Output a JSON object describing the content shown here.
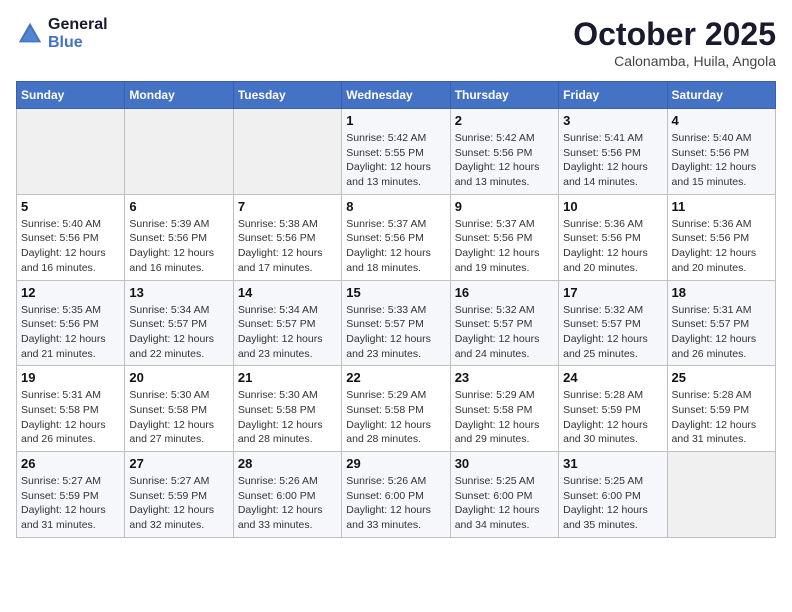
{
  "header": {
    "logo_line1": "General",
    "logo_line2": "Blue",
    "month": "October 2025",
    "location": "Calonamba, Huila, Angola"
  },
  "weekdays": [
    "Sunday",
    "Monday",
    "Tuesday",
    "Wednesday",
    "Thursday",
    "Friday",
    "Saturday"
  ],
  "weeks": [
    [
      {
        "day": "",
        "info": ""
      },
      {
        "day": "",
        "info": ""
      },
      {
        "day": "",
        "info": ""
      },
      {
        "day": "1",
        "info": "Sunrise: 5:42 AM\nSunset: 5:55 PM\nDaylight: 12 hours and 13 minutes."
      },
      {
        "day": "2",
        "info": "Sunrise: 5:42 AM\nSunset: 5:56 PM\nDaylight: 12 hours and 13 minutes."
      },
      {
        "day": "3",
        "info": "Sunrise: 5:41 AM\nSunset: 5:56 PM\nDaylight: 12 hours and 14 minutes."
      },
      {
        "day": "4",
        "info": "Sunrise: 5:40 AM\nSunset: 5:56 PM\nDaylight: 12 hours and 15 minutes."
      }
    ],
    [
      {
        "day": "5",
        "info": "Sunrise: 5:40 AM\nSunset: 5:56 PM\nDaylight: 12 hours and 16 minutes."
      },
      {
        "day": "6",
        "info": "Sunrise: 5:39 AM\nSunset: 5:56 PM\nDaylight: 12 hours and 16 minutes."
      },
      {
        "day": "7",
        "info": "Sunrise: 5:38 AM\nSunset: 5:56 PM\nDaylight: 12 hours and 17 minutes."
      },
      {
        "day": "8",
        "info": "Sunrise: 5:37 AM\nSunset: 5:56 PM\nDaylight: 12 hours and 18 minutes."
      },
      {
        "day": "9",
        "info": "Sunrise: 5:37 AM\nSunset: 5:56 PM\nDaylight: 12 hours and 19 minutes."
      },
      {
        "day": "10",
        "info": "Sunrise: 5:36 AM\nSunset: 5:56 PM\nDaylight: 12 hours and 20 minutes."
      },
      {
        "day": "11",
        "info": "Sunrise: 5:36 AM\nSunset: 5:56 PM\nDaylight: 12 hours and 20 minutes."
      }
    ],
    [
      {
        "day": "12",
        "info": "Sunrise: 5:35 AM\nSunset: 5:56 PM\nDaylight: 12 hours and 21 minutes."
      },
      {
        "day": "13",
        "info": "Sunrise: 5:34 AM\nSunset: 5:57 PM\nDaylight: 12 hours and 22 minutes."
      },
      {
        "day": "14",
        "info": "Sunrise: 5:34 AM\nSunset: 5:57 PM\nDaylight: 12 hours and 23 minutes."
      },
      {
        "day": "15",
        "info": "Sunrise: 5:33 AM\nSunset: 5:57 PM\nDaylight: 12 hours and 23 minutes."
      },
      {
        "day": "16",
        "info": "Sunrise: 5:32 AM\nSunset: 5:57 PM\nDaylight: 12 hours and 24 minutes."
      },
      {
        "day": "17",
        "info": "Sunrise: 5:32 AM\nSunset: 5:57 PM\nDaylight: 12 hours and 25 minutes."
      },
      {
        "day": "18",
        "info": "Sunrise: 5:31 AM\nSunset: 5:57 PM\nDaylight: 12 hours and 26 minutes."
      }
    ],
    [
      {
        "day": "19",
        "info": "Sunrise: 5:31 AM\nSunset: 5:58 PM\nDaylight: 12 hours and 26 minutes."
      },
      {
        "day": "20",
        "info": "Sunrise: 5:30 AM\nSunset: 5:58 PM\nDaylight: 12 hours and 27 minutes."
      },
      {
        "day": "21",
        "info": "Sunrise: 5:30 AM\nSunset: 5:58 PM\nDaylight: 12 hours and 28 minutes."
      },
      {
        "day": "22",
        "info": "Sunrise: 5:29 AM\nSunset: 5:58 PM\nDaylight: 12 hours and 28 minutes."
      },
      {
        "day": "23",
        "info": "Sunrise: 5:29 AM\nSunset: 5:58 PM\nDaylight: 12 hours and 29 minutes."
      },
      {
        "day": "24",
        "info": "Sunrise: 5:28 AM\nSunset: 5:59 PM\nDaylight: 12 hours and 30 minutes."
      },
      {
        "day": "25",
        "info": "Sunrise: 5:28 AM\nSunset: 5:59 PM\nDaylight: 12 hours and 31 minutes."
      }
    ],
    [
      {
        "day": "26",
        "info": "Sunrise: 5:27 AM\nSunset: 5:59 PM\nDaylight: 12 hours and 31 minutes."
      },
      {
        "day": "27",
        "info": "Sunrise: 5:27 AM\nSunset: 5:59 PM\nDaylight: 12 hours and 32 minutes."
      },
      {
        "day": "28",
        "info": "Sunrise: 5:26 AM\nSunset: 6:00 PM\nDaylight: 12 hours and 33 minutes."
      },
      {
        "day": "29",
        "info": "Sunrise: 5:26 AM\nSunset: 6:00 PM\nDaylight: 12 hours and 33 minutes."
      },
      {
        "day": "30",
        "info": "Sunrise: 5:25 AM\nSunset: 6:00 PM\nDaylight: 12 hours and 34 minutes."
      },
      {
        "day": "31",
        "info": "Sunrise: 5:25 AM\nSunset: 6:00 PM\nDaylight: 12 hours and 35 minutes."
      },
      {
        "day": "",
        "info": ""
      }
    ]
  ]
}
